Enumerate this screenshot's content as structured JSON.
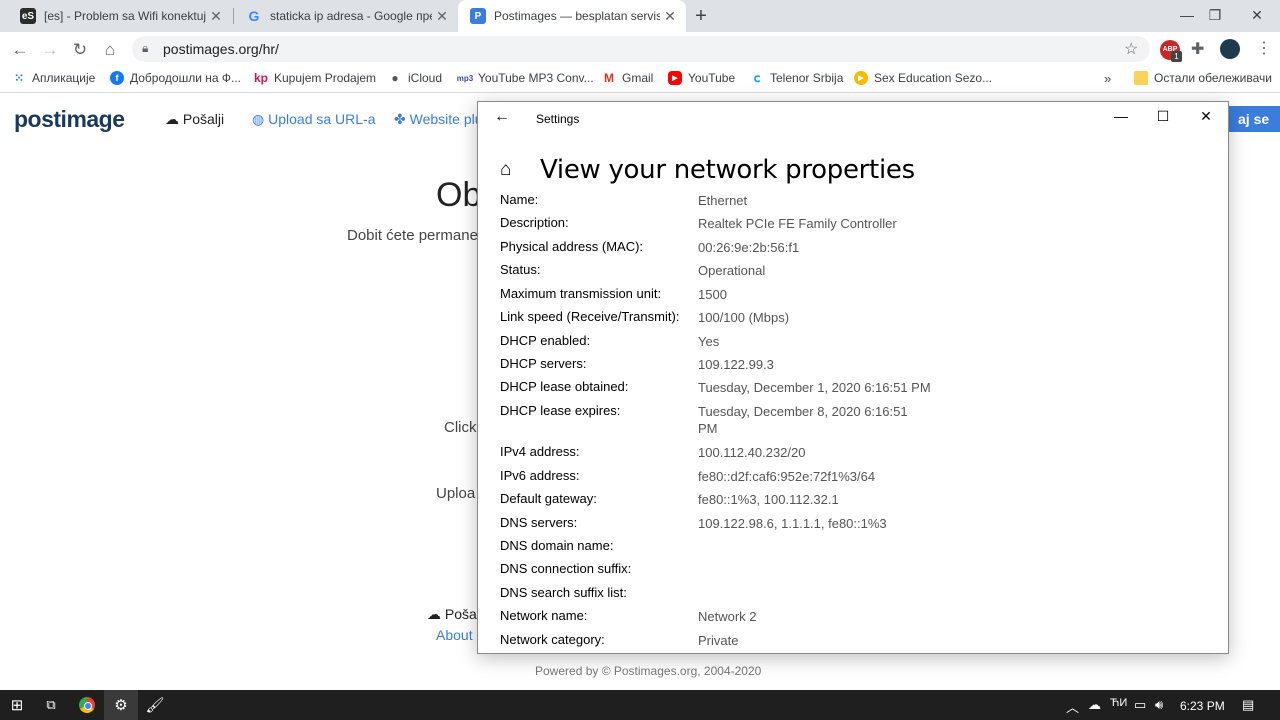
{
  "browser": {
    "tabs": [
      {
        "title": "[es] - Problem sa Wifi konektuje",
        "favicon": "es-favicon",
        "active": false
      },
      {
        "title": "staticka ip adresa - Google претр",
        "favicon": "google-favicon",
        "active": false
      },
      {
        "title": "Postimages — besplatan servis za",
        "favicon": "postimages-favicon",
        "active": true
      }
    ],
    "url": "postimages.org/hr/",
    "bookmarks": [
      {
        "label": "Апликације",
        "icon": "apps-grid-icon"
      },
      {
        "label": "Добродошли на Ф...",
        "icon": "facebook-icon"
      },
      {
        "label": "Kupujem Prodajem",
        "icon": "kp-icon"
      },
      {
        "label": "iCloud",
        "icon": "apple-icon"
      },
      {
        "label": "YouTube MP3 Conv...",
        "icon": "mp3-icon"
      },
      {
        "label": "Gmail",
        "icon": "gmail-icon"
      },
      {
        "label": "YouTube",
        "icon": "youtube-icon"
      },
      {
        "label": "Telenor Srbija",
        "icon": "telenor-icon"
      },
      {
        "label": "Sex Education Sezo...",
        "icon": "play-icon"
      }
    ],
    "other_bookmarks": "Остали обележивачи",
    "ext_badge": "1",
    "ext_label": "ABP"
  },
  "page": {
    "logo": "postimage",
    "nav": [
      {
        "label": "Pošalji",
        "icon": "cloud-upload-icon"
      },
      {
        "label": "Upload sa URL-a",
        "icon": "globe-icon"
      },
      {
        "label": "Website plu",
        "icon": "puzzle-icon"
      }
    ],
    "login_button": "aj se",
    "title_fragment": "Obj",
    "subtitle_fragment": "Dobit ćete permane",
    "click_fragment": "Click",
    "upload_fragment": "Uploa",
    "footer_upload": "Poša",
    "footer_about": "About",
    "powered": "Powered by © Postimages.org, 2004-2020"
  },
  "settings": {
    "window_title": "Settings",
    "heading": "View your network properties",
    "properties": [
      {
        "label": "Name:",
        "value": "Ethernet"
      },
      {
        "label": "Description:",
        "value": "Realtek PCIe FE Family Controller"
      },
      {
        "label": "Physical address (MAC):",
        "value": "00:26:9e:2b:56:f1"
      },
      {
        "label": "Status:",
        "value": "Operational"
      },
      {
        "label": "Maximum transmission unit:",
        "value": "1500"
      },
      {
        "label": "Link speed (Receive/Transmit):",
        "value": "100/100 (Mbps)"
      },
      {
        "label": "DHCP enabled:",
        "value": "Yes"
      },
      {
        "label": "DHCP servers:",
        "value": "109.122.99.3"
      },
      {
        "label": "DHCP lease obtained:",
        "value": "Tuesday, December 1, 2020 6:16:51 PM"
      },
      {
        "label": "DHCP lease expires:",
        "value": "Tuesday, December 8, 2020 6:16:51 PM"
      },
      {
        "label": "IPv4 address:",
        "value": "100.112.40.232/20"
      },
      {
        "label": "IPv6 address:",
        "value": "fe80::d2f:caf6:952e:72f1%3/64"
      },
      {
        "label": "Default gateway:",
        "value": "fe80::1%3, 100.112.32.1"
      },
      {
        "label": "DNS servers:",
        "value": "109.122.98.6, 1.1.1.1, fe80::1%3"
      },
      {
        "label": "DNS domain name:",
        "value": ""
      },
      {
        "label": "DNS connection suffix:",
        "value": ""
      },
      {
        "label": "DNS search suffix list:",
        "value": ""
      },
      {
        "label": "Network name:",
        "value": "Network 2"
      },
      {
        "label": "Network category:",
        "value": "Private"
      }
    ]
  },
  "taskbar": {
    "clock": "6:23 PM",
    "ime": "ЋИ",
    "apps": [
      "windows-start-icon",
      "task-view-icon",
      "chrome-icon",
      "settings-gear-icon",
      "paint-icon"
    ]
  },
  "colors": {
    "accent": "#3b7ddd",
    "link": "#3b7ddd",
    "logo": "#1a3a5c"
  }
}
